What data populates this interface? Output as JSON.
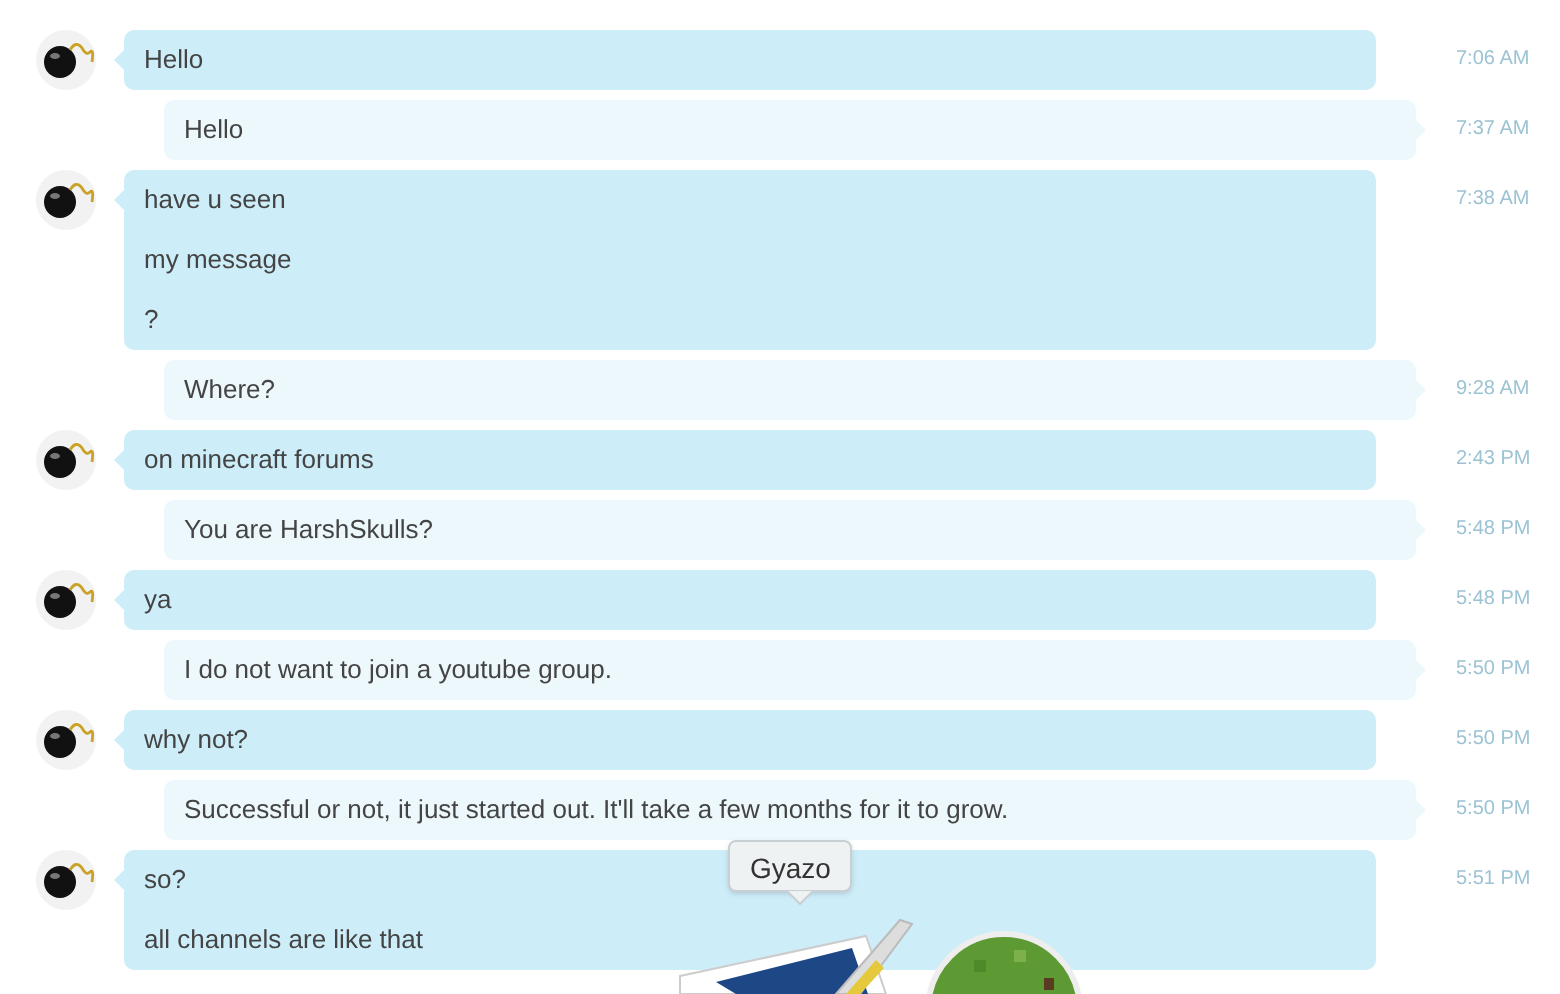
{
  "messages": [
    {
      "kind": "in",
      "lines": [
        "Hello"
      ],
      "time": "7:06 AM"
    },
    {
      "kind": "out",
      "lines": [
        "Hello"
      ],
      "time": "7:37 AM"
    },
    {
      "kind": "in",
      "lines": [
        "have u seen",
        "my message",
        "?"
      ],
      "time": "7:38 AM"
    },
    {
      "kind": "out",
      "lines": [
        "Where?"
      ],
      "time": "9:28 AM"
    },
    {
      "kind": "in",
      "lines": [
        "on minecraft forums"
      ],
      "time": "2:43 PM"
    },
    {
      "kind": "out",
      "lines": [
        "You are HarshSkulls?"
      ],
      "time": "5:48 PM"
    },
    {
      "kind": "in",
      "lines": [
        "ya"
      ],
      "time": "5:48 PM"
    },
    {
      "kind": "out",
      "lines": [
        "I do not want to join a youtube group."
      ],
      "time": "5:50 PM"
    },
    {
      "kind": "in",
      "lines": [
        "why not?"
      ],
      "time": "5:50 PM"
    },
    {
      "kind": "out",
      "lines": [
        "Successful or not, it just started out. It'll take a few months for it to grow."
      ],
      "time": "5:50 PM"
    },
    {
      "kind": "in",
      "lines": [
        "so?",
        "all channels are like that"
      ],
      "time": "5:51 PM"
    }
  ],
  "dock": {
    "tooltip": "Gyazo"
  }
}
